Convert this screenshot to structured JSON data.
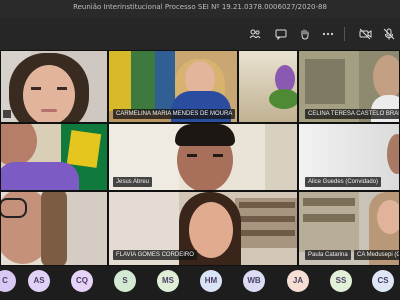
{
  "window": {
    "title": "Reunião Interinstitucional Processo SEI Nº 19.21.0378.0006027/2020-88"
  },
  "toolbar": {
    "icons": [
      "people-icon",
      "chat-icon",
      "raise-hand-icon",
      "more-icon",
      "camera-off-icon",
      "mic-off-icon"
    ]
  },
  "participants": [
    {
      "name": ""
    },
    {
      "name": "CARMELINA MARIA MENDES DE MOURA"
    },
    {
      "name": "CELINA TERESA CASTELO BRANCO"
    },
    {
      "name": ""
    },
    {
      "name": "Jesus Abreu"
    },
    {
      "name": "Alice Guedes (Convidado)"
    },
    {
      "name": ""
    },
    {
      "name": "FLAVIA GOMES CORDEIRO"
    },
    {
      "name": "Paula Catarina"
    },
    {
      "name": "CA Medusepi (Co"
    }
  ],
  "avatars": [
    {
      "initials": "C",
      "color": "#d9c8f3"
    },
    {
      "initials": "AS",
      "color": "#e1d1f7"
    },
    {
      "initials": "CQ",
      "color": "#e6d3f7"
    },
    {
      "initials": "S",
      "color": "#d4e9d2"
    },
    {
      "initials": "MS",
      "color": "#dfefd7"
    },
    {
      "initials": "HM",
      "color": "#dbe3f6"
    },
    {
      "initials": "WB",
      "color": "#d9dcf4"
    },
    {
      "initials": "JA",
      "color": "#f5ded3"
    },
    {
      "initials": "SS",
      "color": "#e2f0d8"
    },
    {
      "initials": "CS",
      "color": "#dfe6f6"
    }
  ]
}
